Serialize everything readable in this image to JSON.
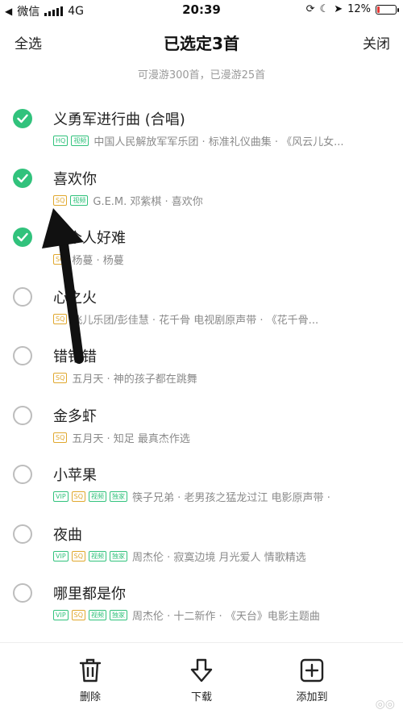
{
  "status_bar": {
    "carrier": "微信",
    "network": "4G",
    "time": "20:39",
    "battery": "12%",
    "battery_level": 0.12,
    "battery_color": "#e53935"
  },
  "nav": {
    "select_all": "全选",
    "title": "已选定3首",
    "close": "关闭"
  },
  "subinfo": "可漫游300首，已漫游25首",
  "songs": [
    {
      "title": "义勇军进行曲 (合唱)",
      "checked": true,
      "tags": [
        "HQ",
        "视频"
      ],
      "meta": "中国人民解放军军乐团 · 标准礼仪曲集 · 《风云儿女..."
    },
    {
      "title": "喜欢你",
      "checked": true,
      "tags": [
        "SQ",
        "视频"
      ],
      "meta": "G.E.M. 邓紫棋 · 喜欢你"
    },
    {
      "title": "一个人好难",
      "checked": true,
      "tags": [
        "SQ"
      ],
      "meta": "杨蔓 · 杨蔓"
    },
    {
      "title": "心之火",
      "checked": false,
      "tags": [
        "SQ"
      ],
      "meta": "飞儿乐团/彭佳慧 · 花千骨 电视剧原声带 · 《花千骨..."
    },
    {
      "title": "错错错",
      "checked": false,
      "tags": [
        "SQ"
      ],
      "meta": "五月天 · 神的孩子都在跳舞"
    },
    {
      "title": "金多虾",
      "checked": false,
      "tags": [
        "SQ"
      ],
      "meta": "五月天 · 知足 最真杰作选"
    },
    {
      "title": "小苹果",
      "checked": false,
      "tags": [
        "VIP",
        "SQ",
        "视频",
        "独家"
      ],
      "meta": "筷子兄弟 · 老男孩之猛龙过江 电影原声带 ·"
    },
    {
      "title": "夜曲",
      "checked": false,
      "tags": [
        "VIP",
        "SQ",
        "视频",
        "独家"
      ],
      "meta": "周杰伦 · 寂寞边境 月光爱人 情歌精选"
    },
    {
      "title": "哪里都是你",
      "checked": false,
      "tags": [
        "VIP",
        "SQ",
        "视频",
        "独家"
      ],
      "meta": "周杰伦 · 十二新作 · 《天台》电影主题曲"
    }
  ],
  "toolbar": {
    "delete": "删除",
    "download": "下载",
    "add_to": "添加到"
  },
  "accent_color": "#31c27c"
}
